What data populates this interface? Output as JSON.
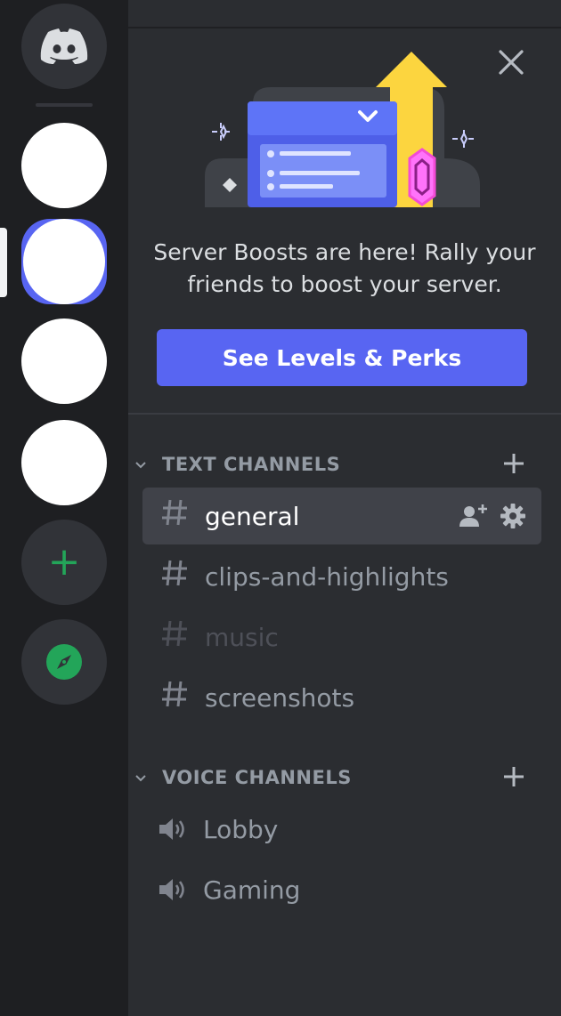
{
  "server_rail": {
    "home_icon": "discord-logo-icon",
    "add_server_icon": "plus-icon",
    "explore_icon": "compass-icon",
    "add_server_glyph": "+"
  },
  "banner": {
    "text": "Server Boosts are here! Rally your friends to boost your server.",
    "button_label": "See Levels & Perks"
  },
  "text_category": {
    "label": "TEXT CHANNELS",
    "channels": [
      {
        "name": "general",
        "state": "selected"
      },
      {
        "name": "clips-and-highlights",
        "state": "normal"
      },
      {
        "name": "music",
        "state": "muted"
      },
      {
        "name": "screenshots",
        "state": "normal"
      }
    ]
  },
  "voice_category": {
    "label": "VOICE CHANNELS",
    "channels": [
      {
        "name": "Lobby"
      },
      {
        "name": "Gaming"
      }
    ]
  },
  "colors": {
    "accent": "#5865f2",
    "add_green": "#23a559",
    "rail_bg": "#1e1f22",
    "sidebar_bg": "#2b2d31"
  }
}
